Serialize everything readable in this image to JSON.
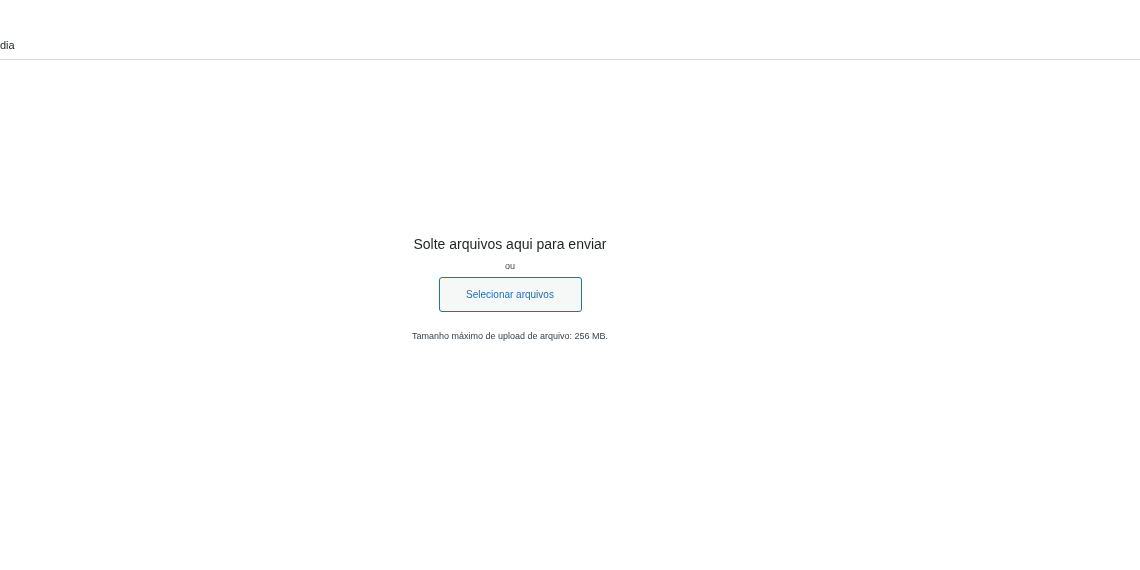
{
  "header": {
    "title": "dia"
  },
  "uploader": {
    "instructions": "Solte arquivos aqui para enviar",
    "separator": "ou",
    "button": "Selecionar arquivos",
    "max_size": "Tamanho máximo de upload de arquivo: 256 MB."
  }
}
